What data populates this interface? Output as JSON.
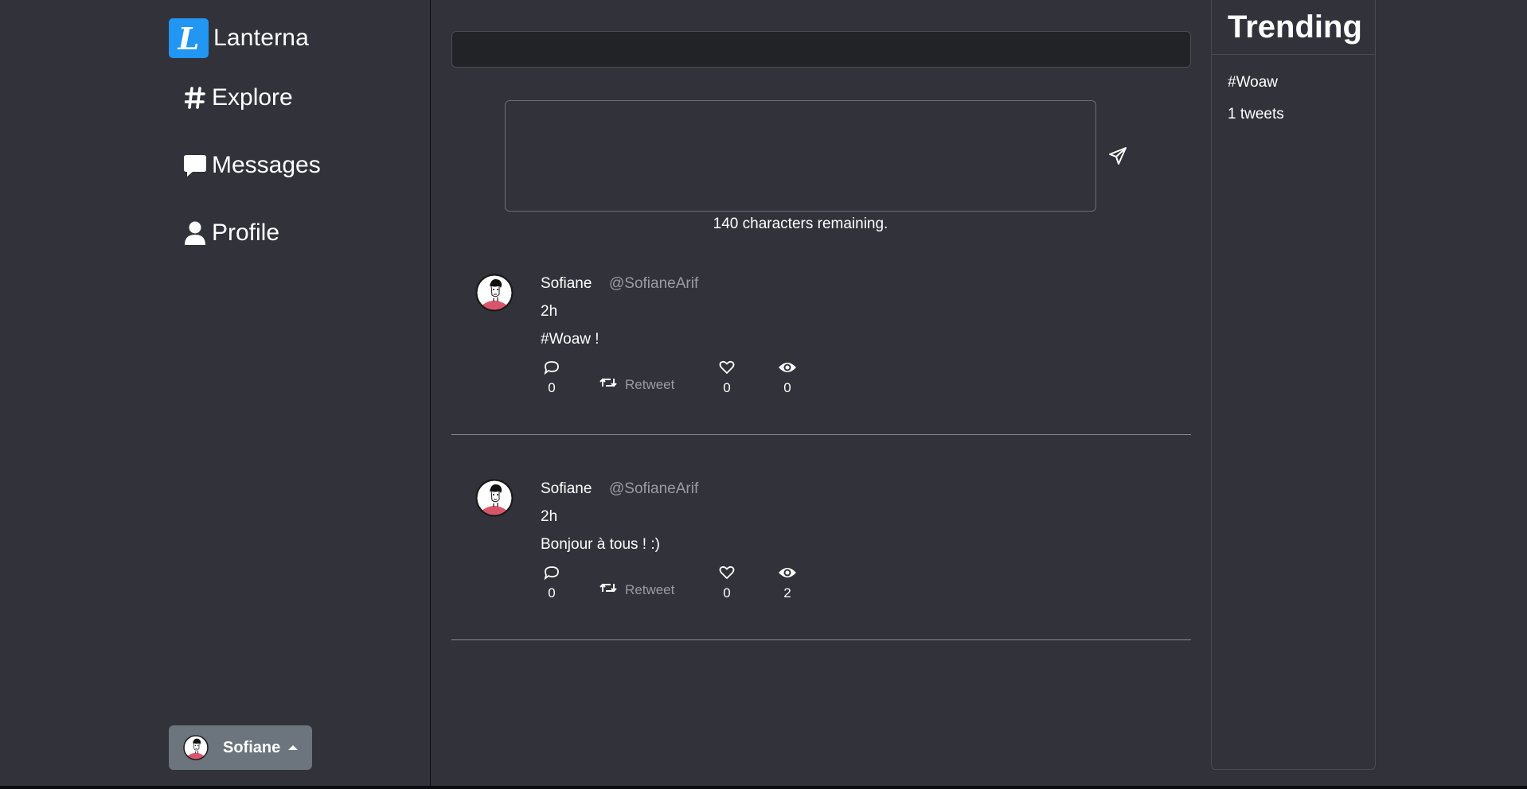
{
  "sidebar": {
    "brand": {
      "logo_letter": "L",
      "name": "Lanterna",
      "accent": "#2196f3"
    },
    "nav": {
      "explore": {
        "label": "Explore",
        "icon": "hash-icon"
      },
      "messages": {
        "label": "Messages",
        "icon": "message-icon"
      },
      "profile": {
        "label": "Profile",
        "icon": "user-icon"
      }
    },
    "user_menu": {
      "name": "Sofiane",
      "icon": "caret-up-icon",
      "color": "#6c757d"
    }
  },
  "compose": {
    "value": "",
    "chars_remaining": "140 characters remaining.",
    "send_icon": "send-icon"
  },
  "tweets": [
    {
      "name": "Sofiane",
      "handle": "@SofianeArif",
      "time": "2h",
      "text": "#Woaw !",
      "replies": "0",
      "retweet_label": "Retweet",
      "likes": "0",
      "views": "0"
    },
    {
      "name": "Sofiane",
      "handle": "@SofianeArif",
      "time": "2h",
      "text": "Bonjour à tous ! :)",
      "replies": "0",
      "retweet_label": "Retweet",
      "likes": "0",
      "views": "2"
    }
  ],
  "trending": {
    "title": "Trending",
    "items": [
      {
        "tag": "#Woaw",
        "count": "1 tweets"
      }
    ]
  },
  "colors": {
    "background": "#31323a",
    "input_bg": "#212327",
    "muted_text": "#9a9ca2"
  }
}
